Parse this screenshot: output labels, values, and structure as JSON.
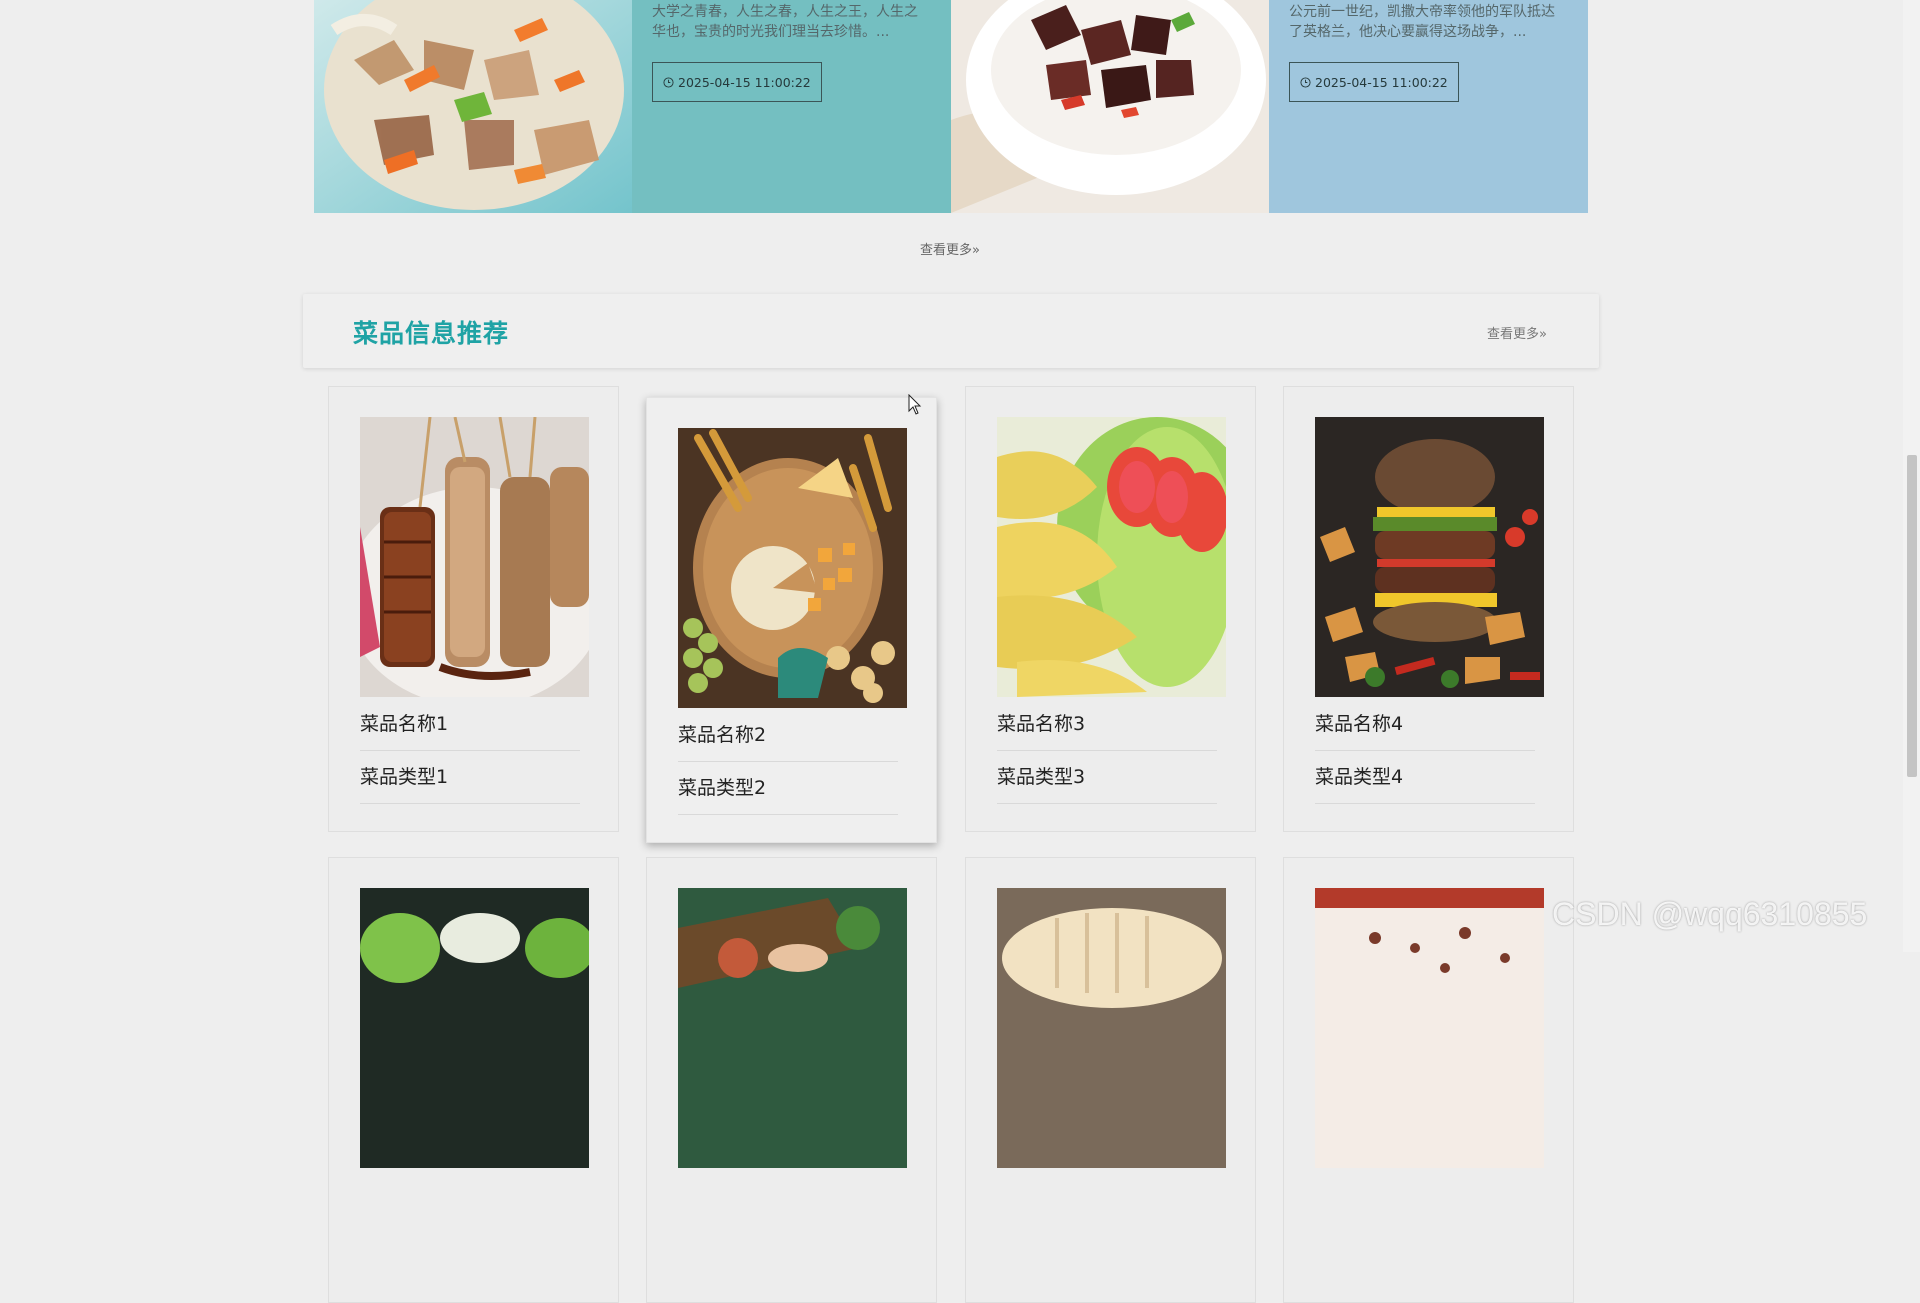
{
  "news": [
    {
      "excerpt": "大学之青春，人生之春，人生之王，人生之华也，宝贵的时光我们理当去珍惜。...",
      "date": "2025-04-15 11:00:22"
    },
    {
      "excerpt": "公元前一世纪，凯撒大帝率领他的军队抵达了英格兰，他决心要赢得这场战争，...",
      "date": "2025-04-15 11:00:22"
    }
  ],
  "news_more": "查看更多",
  "section": {
    "title": "菜品信息推荐",
    "more": "查看更多"
  },
  "dishes": [
    {
      "name": "菜品名称1",
      "type": "菜品类型1",
      "image": "grilled-skewers"
    },
    {
      "name": "菜品名称2",
      "type": "菜品类型2",
      "image": "cheese-board"
    },
    {
      "name": "菜品名称3",
      "type": "菜品类型3",
      "image": "dumplings-salad"
    },
    {
      "name": "菜品名称4",
      "type": "菜品类型4",
      "image": "burger-fries"
    }
  ],
  "watermark": "CSDN @wqq6310855"
}
